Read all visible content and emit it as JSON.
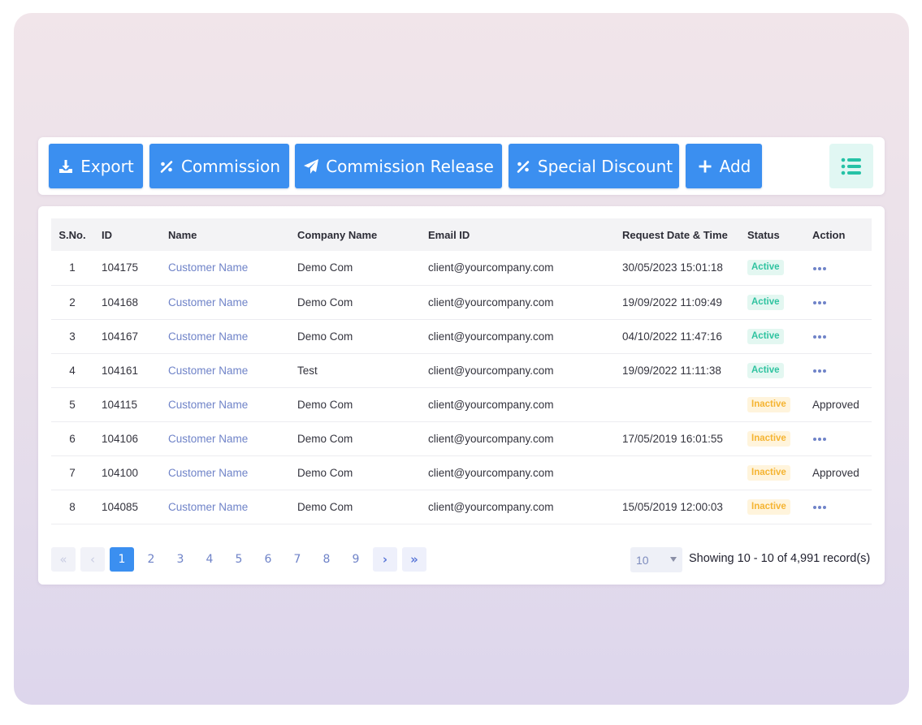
{
  "toolbar": {
    "buttons": [
      {
        "label": "Export",
        "icon": "download-icon"
      },
      {
        "label": "Commission",
        "icon": "percent-icon"
      },
      {
        "label": "Commission Release",
        "icon": "paper-plane-icon"
      },
      {
        "label": "Special Discount",
        "icon": "percent-icon"
      },
      {
        "label": "Add",
        "icon": "plus-icon"
      }
    ],
    "list_toggle_icon": "list-icon"
  },
  "table": {
    "columns": [
      "S.No.",
      "ID",
      "Name",
      "Company Name",
      "Email ID",
      "Request Date & Time",
      "Status",
      "Action"
    ],
    "rows": [
      {
        "sno": "1",
        "id": "104175",
        "name": "Customer Name",
        "company": "Demo Com",
        "email": "client@yourcompany.com",
        "date": "30/05/2023 15:01:18",
        "status": "Active",
        "action": "menu"
      },
      {
        "sno": "2",
        "id": "104168",
        "name": "Customer Name",
        "company": "Demo Com",
        "email": "client@yourcompany.com",
        "date": "19/09/2022 11:09:49",
        "status": "Active",
        "action": "menu"
      },
      {
        "sno": "3",
        "id": "104167",
        "name": "Customer Name",
        "company": "Demo Com",
        "email": "client@yourcompany.com",
        "date": "04/10/2022 11:47:16",
        "status": "Active",
        "action": "menu"
      },
      {
        "sno": "4",
        "id": "104161",
        "name": "Customer Name",
        "company": "Test",
        "email": "client@yourcompany.com",
        "date": "19/09/2022 11:11:38",
        "status": "Active",
        "action": "menu"
      },
      {
        "sno": "5",
        "id": "104115",
        "name": "Customer Name",
        "company": "Demo Com",
        "email": "client@yourcompany.com",
        "date": "",
        "status": "Inactive",
        "action": "Approved"
      },
      {
        "sno": "6",
        "id": "104106",
        "name": "Customer Name",
        "company": "Demo Com",
        "email": "client@yourcompany.com",
        "date": "17/05/2019 16:01:55",
        "status": "Inactive",
        "action": "menu"
      },
      {
        "sno": "7",
        "id": "104100",
        "name": "Customer Name",
        "company": "Demo Com",
        "email": "client@yourcompany.com",
        "date": "",
        "status": "Inactive",
        "action": "Approved"
      },
      {
        "sno": "8",
        "id": "104085",
        "name": "Customer Name",
        "company": "Demo Com",
        "email": "client@yourcompany.com",
        "date": "15/05/2019 12:00:03",
        "status": "Inactive",
        "action": "menu"
      }
    ]
  },
  "pagination": {
    "first": "«",
    "prev": "‹",
    "pages": [
      "1",
      "2",
      "3",
      "4",
      "5",
      "6",
      "7",
      "8",
      "9"
    ],
    "current": "1",
    "next": "›",
    "last": "»",
    "page_size": "10",
    "showing": "Showing 10 - 10 of 4,991 record(s)"
  },
  "colors": {
    "primary": "#3b8ff0",
    "link": "#6f83c8",
    "active_text": "#2fc3a0",
    "active_bg": "#e3f7f1",
    "inactive_text": "#f5b432",
    "inactive_bg": "#fff4dc"
  }
}
